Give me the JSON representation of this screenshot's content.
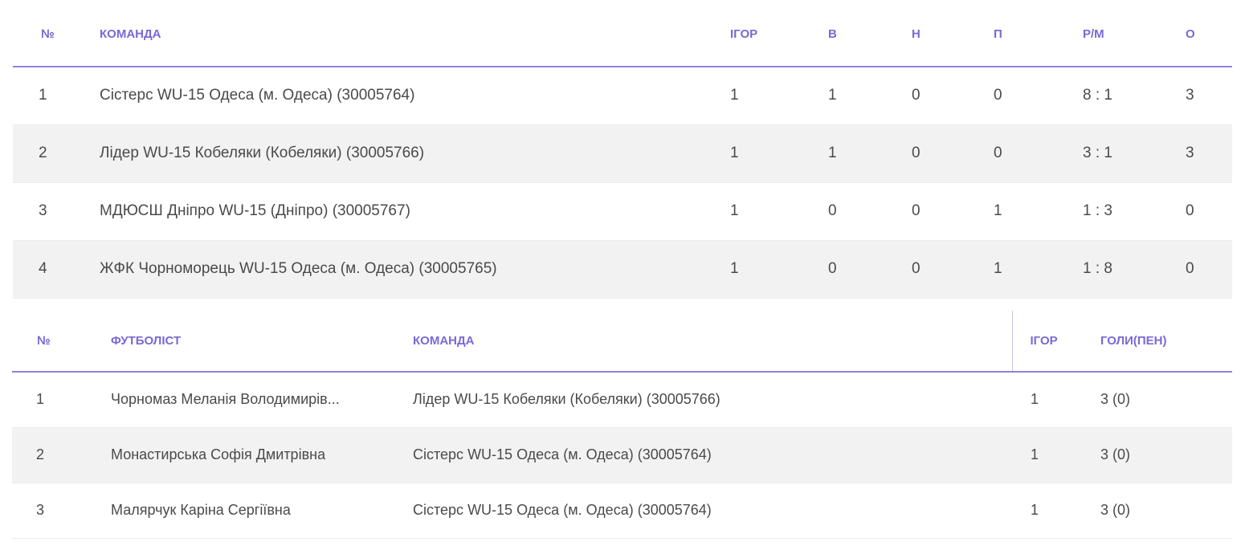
{
  "standings": {
    "headers": [
      "№",
      "КОМАНДА",
      "ІГОР",
      "В",
      "Н",
      "П",
      "Р/М",
      "О"
    ],
    "rows": [
      [
        "1",
        "Сістерс WU-15 Одеса (м. Одеса) (30005764)",
        "1",
        "1",
        "0",
        "0",
        "8 : 1",
        "3"
      ],
      [
        "2",
        "Лідер WU-15 Кобеляки (Кобеляки) (30005766)",
        "1",
        "1",
        "0",
        "0",
        "3 : 1",
        "3"
      ],
      [
        "3",
        "МДЮСШ Дніпро WU-15 (Дніпро) (30005767)",
        "1",
        "0",
        "0",
        "1",
        "1 : 3",
        "0"
      ],
      [
        "4",
        "ЖФК Чорноморець WU-15 Одеса (м. Одеса) (30005765)",
        "1",
        "0",
        "0",
        "1",
        "1 : 8",
        "0"
      ]
    ]
  },
  "scorers": {
    "headers": [
      "№",
      "ФУТБОЛІСТ",
      "КОМАНДА",
      "ІГОР",
      "ГОЛИ(ПЕН)"
    ],
    "rows": [
      [
        "1",
        "Чорномаз Меланія Володимирів...",
        "Лідер WU-15 Кобеляки (Кобеляки) (30005766)",
        "1",
        "3 (0)"
      ],
      [
        "2",
        "Монастирська Софія Дмитрівна",
        "Сістерс WU-15 Одеса (м. Одеса) (30005764)",
        "1",
        "3 (0)"
      ],
      [
        "3",
        "Малярчук Каріна Сергіївна",
        "Сістерс WU-15 Одеса (м. Одеса) (30005764)",
        "1",
        "3 (0)"
      ]
    ]
  }
}
